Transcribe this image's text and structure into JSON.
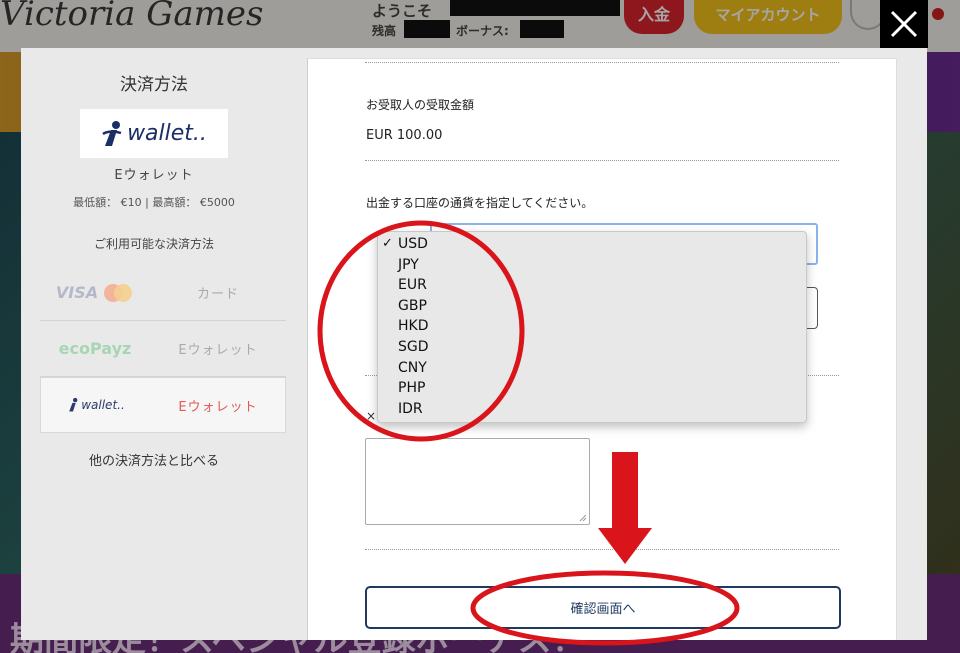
{
  "site": {
    "logo": "Victoria Games",
    "welcome": "ようこそ",
    "balance_label": "残高",
    "bonus_label": "ボーナス:",
    "deposit_button": "入金",
    "account_button": "マイアカウント",
    "promo_text": "期間限定！スペシャル登録ボーナス！"
  },
  "sidebar": {
    "title": "決済方法",
    "selected_logo_text": "wallet..",
    "method_name": "Eウォレット",
    "limits": "最低額： €10 | 最高額： €5000",
    "available_label": "ご利用可能な決済方法",
    "methods": [
      {
        "logo": "VISA",
        "logo2": "MasterCard",
        "label": "カード",
        "selected": false
      },
      {
        "logo": "ecoPayz",
        "label": "Eウォレット",
        "selected": false
      },
      {
        "logo": "wallet..",
        "label": "Eウォレット",
        "selected": true
      }
    ],
    "compare_link": "他の決済方法と比べる"
  },
  "form": {
    "receive_label": "お受取人の受取金額",
    "receive_value": "EUR 100.00",
    "currency_prompt": "出金する口座の通貨を指定してください。",
    "x_mark": "×",
    "confirm_button": "確認画面へ"
  },
  "currency_dropdown": {
    "selected": "USD",
    "options": [
      "USD",
      "JPY",
      "EUR",
      "GBP",
      "HKD",
      "SGD",
      "CNY",
      "PHP",
      "IDR"
    ]
  },
  "colors": {
    "annotation_red": "#d9141b",
    "confirm_border": "#1f3a5f",
    "accent_red": "#e05a5a"
  }
}
